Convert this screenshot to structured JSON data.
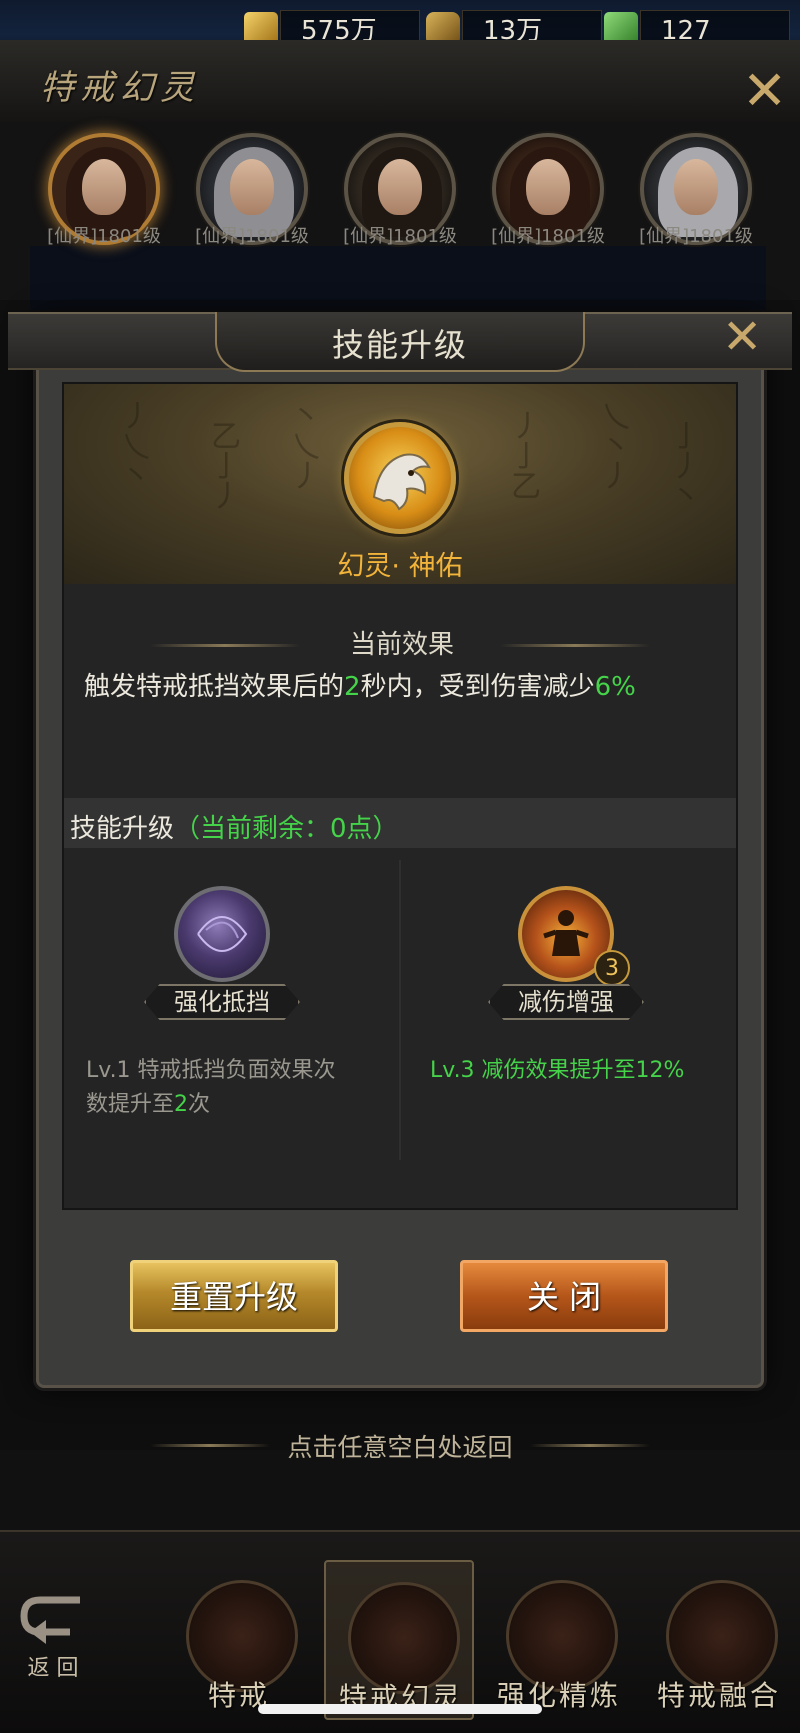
{
  "currency": [
    {
      "icon": "gold-coin-icon",
      "value": "575万"
    },
    {
      "icon": "token-icon",
      "value": "13万"
    },
    {
      "icon": "ingot-icon",
      "value": "127"
    }
  ],
  "header": {
    "title": "特戒幻灵"
  },
  "heroes": [
    {
      "label": "[仙界]1801级",
      "selected": true
    },
    {
      "label": "[仙界]1801级",
      "selected": false
    },
    {
      "label": "[仙界]1801级",
      "selected": false
    },
    {
      "label": "[仙界]1801级",
      "selected": false
    },
    {
      "label": "[仙界]1801级",
      "selected": false
    }
  ],
  "dialog": {
    "title": "技能升级",
    "skill_name": "幻灵· 神佑",
    "current_effect_title": "当前效果",
    "effect": {
      "part1": "触发特戒抵挡效果后的",
      "num1": "2",
      "part2": "秒内，受到伤害减少",
      "num2": "6%"
    },
    "upgrade": {
      "label": "技能升级",
      "remaining": "（当前剩余：0点）"
    },
    "nodes": [
      {
        "name": "强化抵挡",
        "desc1": "Lv.1 特戒抵挡负面效果次",
        "desc2_pre": "数提升至",
        "desc2_num": "2",
        "desc2_post": "次"
      },
      {
        "name": "减伤增强",
        "level": "3",
        "desc": "Lv.3 减伤效果提升至12%"
      }
    ],
    "buttons": {
      "reset": "重置升级",
      "close": "关 闭"
    }
  },
  "hint": "点击任意空白处返回",
  "bottom_nav": {
    "back": "返 回",
    "items": [
      "特戒",
      "特戒幻灵",
      "强化精炼",
      "特戒融合"
    ],
    "selected_index": 1
  },
  "colors": {
    "gold": "#f2b43a",
    "green": "#45d34a",
    "panel": "#242424"
  }
}
